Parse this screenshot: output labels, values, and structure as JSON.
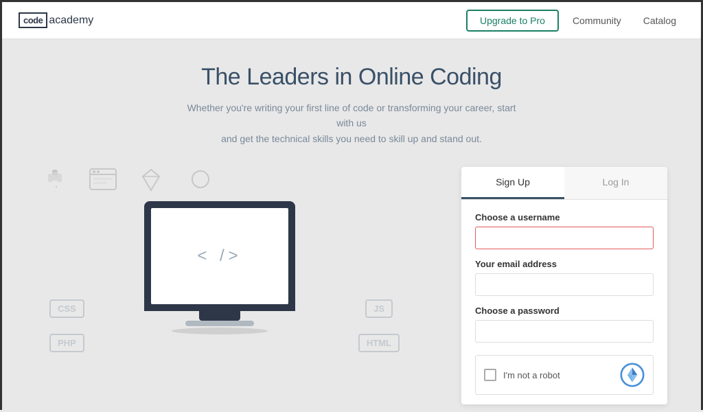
{
  "header": {
    "logo_code": "code",
    "logo_academy": "academy",
    "upgrade_button": "Upgrade to Pro",
    "nav_community": "Community",
    "nav_catalog": "Catalog"
  },
  "hero": {
    "title": "The Leaders in Online Coding",
    "subtitle_line1": "Whether you're writing your first line of code or transforming your career, start with us",
    "subtitle_line2": "and get the technical skills you need to skill up and stand out."
  },
  "illustration": {
    "badge_css": "CSS",
    "badge_js": "JS",
    "badge_php": "PHP",
    "badge_html": "HTML",
    "code_display": "< />"
  },
  "form": {
    "tab_signup": "Sign Up",
    "tab_login": "Log In",
    "username_label": "Choose a username",
    "username_placeholder": "",
    "email_label": "Your email address",
    "email_placeholder": "",
    "password_label": "Choose a password",
    "password_placeholder": "",
    "recaptcha_text": "I'm not a robot"
  },
  "colors": {
    "accent": "#1a7f64",
    "header_bg": "#ffffff",
    "main_bg": "#e8e8e8",
    "text_dark": "#3a5068",
    "text_muted": "#7a8899",
    "border": "#e0e0e0"
  }
}
